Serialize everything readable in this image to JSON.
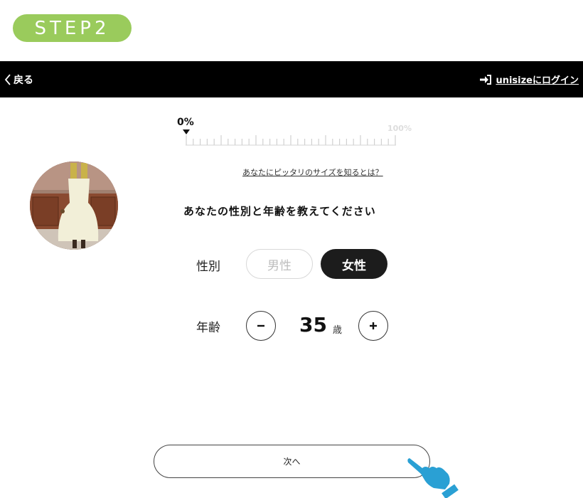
{
  "step_badge": "STEP2",
  "topbar": {
    "back_label": "戻る",
    "login_label": "unisizeにログイン"
  },
  "progress": {
    "start_label": "0%",
    "end_label": "100%",
    "value_percent": 0
  },
  "help_link": "あなたにピッタリのサイズを知るとは？",
  "question": "あなたの性別と年齢を教えてください",
  "gender": {
    "label": "性別",
    "options": [
      "男性",
      "女性"
    ],
    "selected": "女性"
  },
  "age": {
    "label": "年齢",
    "value": "35",
    "unit": "歳"
  },
  "next_button": "次へ",
  "colors": {
    "badge": "#9acb5c",
    "topbar": "#000000",
    "selected": "#1c1c1c",
    "pointer": "#2aa0d4"
  },
  "icons": {
    "back": "chevron-left-icon",
    "login": "sign-in-icon",
    "minus": "minus-icon",
    "plus": "plus-icon",
    "hand": "pointing-hand-icon"
  }
}
